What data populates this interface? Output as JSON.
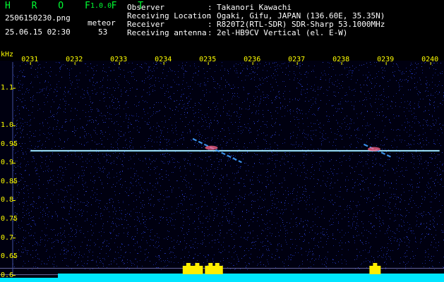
{
  "app": {
    "name": "H R O F F T",
    "version": "1.0.0"
  },
  "file": {
    "name": "2506150230.png",
    "datetime": "25.06.15 02:30"
  },
  "meteor": {
    "label": "meteor",
    "count": "53"
  },
  "info": [
    {
      "key": "Observer",
      "sep": ":",
      "value": "Takanori Kawachi"
    },
    {
      "key": "Receiving Location",
      "sep": ":",
      "value": "Ogaki, Gifu, JAPAN (136.60E, 35.35N)"
    },
    {
      "key": "Receiver",
      "sep": ":",
      "value": "R820T2(RTL-SDR) SDR-Sharp 53.1000MHz"
    },
    {
      "key": "Receiving antenna",
      "sep": ":",
      "value": "2el-HB9CV Vertical (el. E-W)"
    }
  ],
  "colors": {
    "title_green": "#00ff33",
    "tick_yellow": "#ffff00",
    "background": "#000010",
    "noise_blue": "#1a2aa0",
    "signal": "#7fdfff",
    "level_fill": "#00e5ff",
    "level_peak": "#ffee00"
  },
  "chart_data": {
    "type": "heatmap",
    "title": "",
    "xlabel": "",
    "ylabel": "kHz",
    "x_tick_labels": [
      "0231",
      "0232",
      "0233",
      "0234",
      "0235",
      "0236",
      "0237",
      "0238",
      "0239",
      "0240"
    ],
    "y_tick_labels": [
      "1.1",
      "1.0",
      "0.95",
      "0.9",
      "0.85",
      "0.8",
      "0.75",
      "0.7",
      "0.65",
      "0.6"
    ],
    "x_ticks_minutes": [
      1,
      2,
      3,
      4,
      5,
      6,
      7,
      8,
      9,
      10
    ],
    "y_ticks_khz": [
      1.1,
      1.0,
      0.95,
      0.9,
      0.85,
      0.8,
      0.75,
      0.7,
      0.65,
      0.6
    ],
    "xlim_minutes": [
      0.6,
      10.3
    ],
    "ylim_khz": [
      0.59,
      1.17
    ],
    "carrier": {
      "freq_khz": 0.933,
      "t_start_min": 1.0,
      "t_end_min": 10.2
    },
    "meteor_echoes": [
      {
        "t_start_min": 4.65,
        "t_end_min": 5.75,
        "f_start_khz": 0.965,
        "f_end_khz": 0.902
      },
      {
        "t_start_min": 8.5,
        "t_end_min": 9.1,
        "f_start_khz": 0.95,
        "f_end_khz": 0.917
      }
    ],
    "level_peaks_min": [
      4.55,
      4.75,
      5.05,
      5.2,
      8.75
    ],
    "grid": false
  }
}
